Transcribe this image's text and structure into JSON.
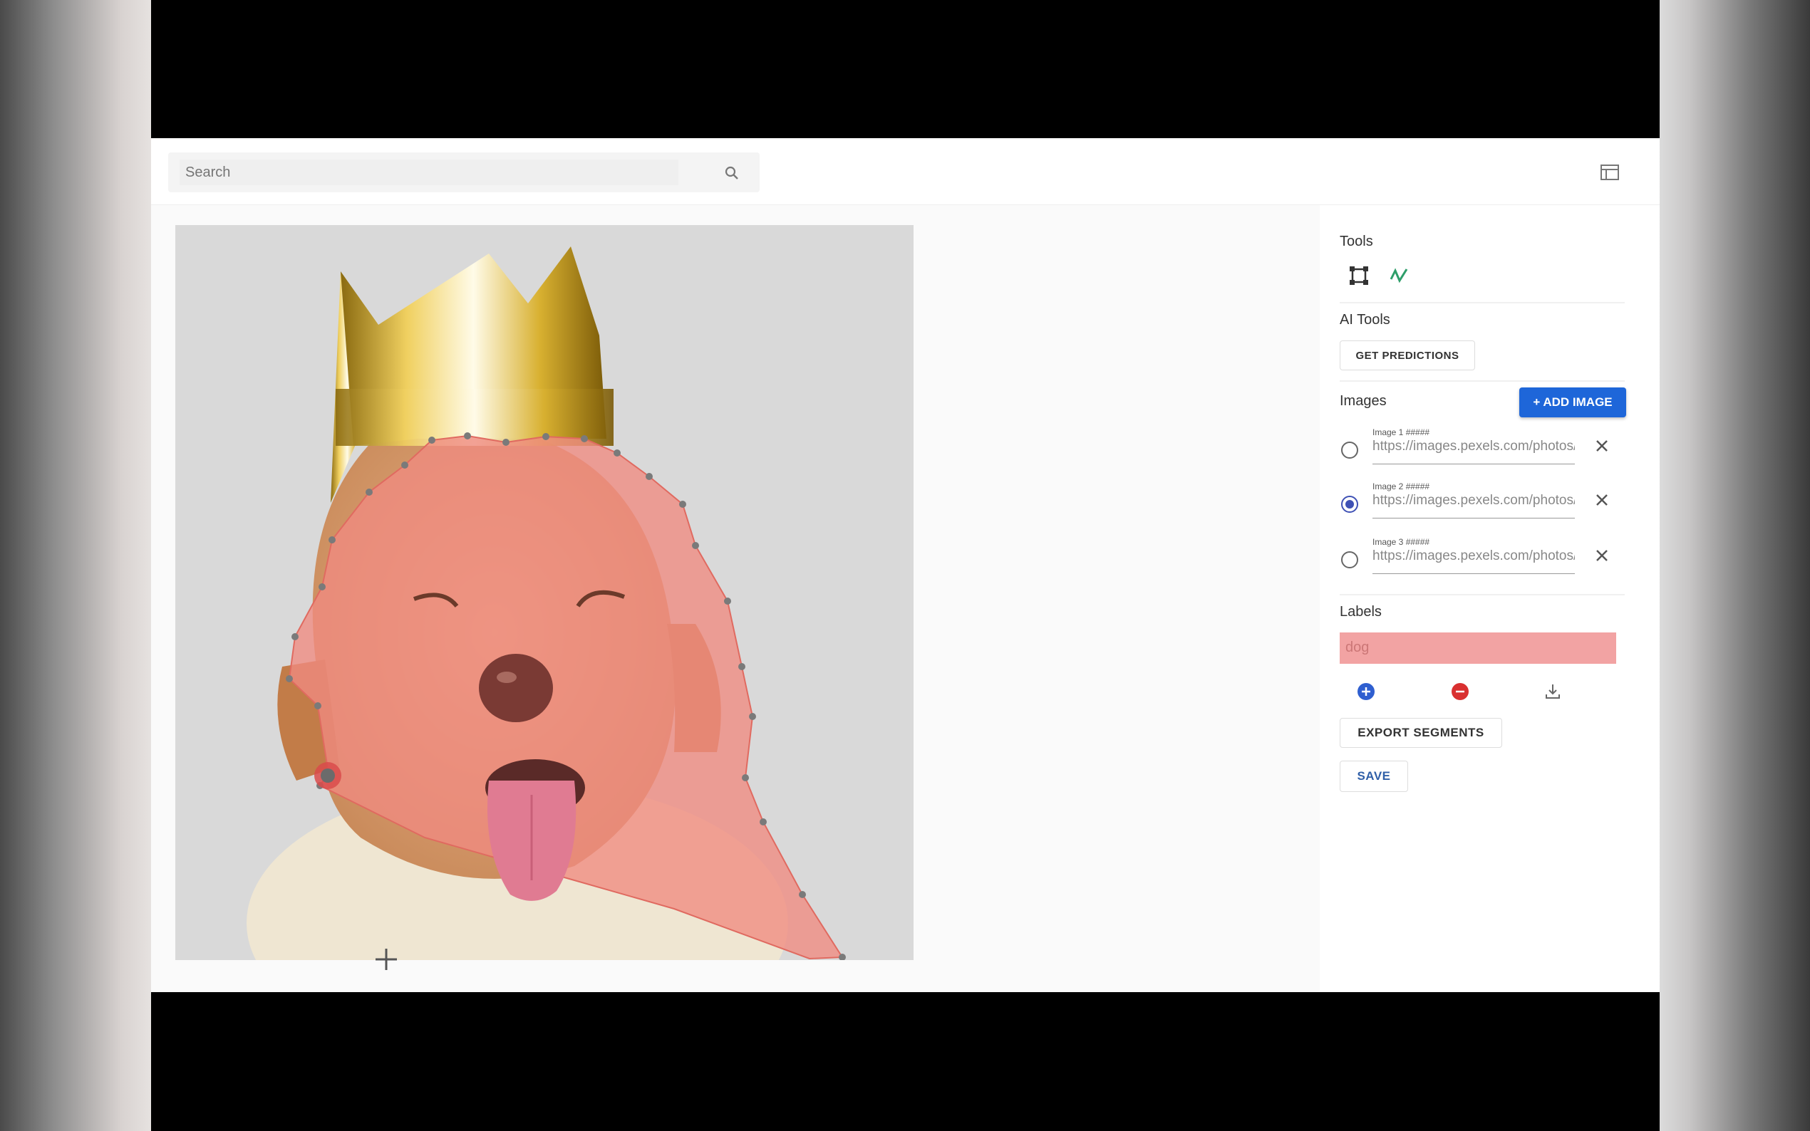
{
  "search": {
    "placeholder": "Search"
  },
  "sidebar": {
    "tools_title": "Tools",
    "tool_icons": [
      "bounding-box-icon",
      "polygon-icon"
    ],
    "ai_tools_title": "AI Tools",
    "get_predictions_label": "GET PREDICTIONS",
    "images_title": "Images",
    "add_image_label": "+ ADD IMAGE",
    "images": [
      {
        "name": "Image 1 #####",
        "url": "https://images.pexels.com/photos/",
        "selected": false
      },
      {
        "name": "Image 2 #####",
        "url": "https://images.pexels.com/photos/",
        "selected": true
      },
      {
        "name": "Image 3 #####",
        "url": "https://images.pexels.com/photos/",
        "selected": false
      }
    ],
    "labels_title": "Labels",
    "label_value": "dog",
    "label_actions": [
      "add-label-icon",
      "delete-label-icon",
      "download-icon"
    ],
    "export_label": "EXPORT SEGMENTS",
    "save_label": "SAVE"
  },
  "colors": {
    "accent": "#1e66d9",
    "segment_fill": "#f08a80",
    "label_bg": "#f2a3a3",
    "radio_selected": "#3f51b5"
  }
}
